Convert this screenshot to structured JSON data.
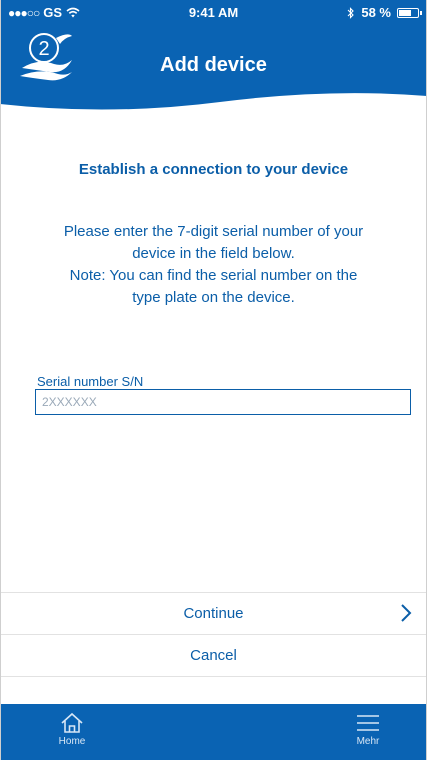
{
  "status_bar": {
    "carrier": "GS",
    "time": "9:41 AM",
    "battery": "58 %",
    "battery_level": 0.58
  },
  "header": {
    "logo_number": "2",
    "title": "Add device"
  },
  "content": {
    "headline": "Establish a connection to your device",
    "instructions": [
      "Please enter the 7-digit serial number of your",
      "device in the field below.",
      "Note: You can find the serial number on the",
      "type plate on the device."
    ],
    "serial_field": {
      "label": "Serial number S/N",
      "placeholder": "2XXXXXX",
      "value": ""
    }
  },
  "actions": {
    "continue_label": "Continue",
    "cancel_label": "Cancel"
  },
  "tabbar": {
    "home_label": "Home",
    "more_label": "Mehr"
  },
  "colors": {
    "brand_blue": "#0a63b3",
    "text_blue": "#0b5ea8"
  },
  "icons": [
    "wifi-icon",
    "bluetooth-icon",
    "battery-icon",
    "logo-icon",
    "chevron-right-icon",
    "home-icon",
    "menu-icon"
  ]
}
